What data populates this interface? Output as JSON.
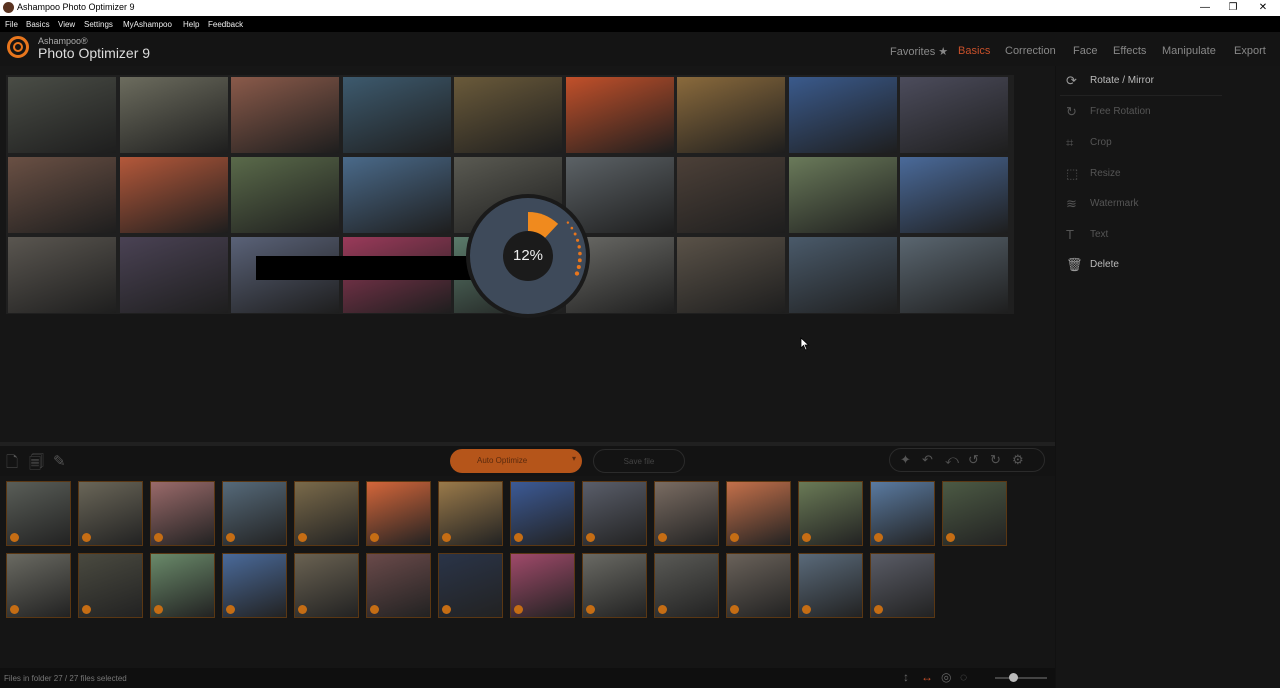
{
  "window": {
    "title": "Ashampoo Photo Optimizer 9",
    "minimize": "—",
    "maximize": "❐",
    "close": "✕"
  },
  "menu": [
    "File",
    "Basics",
    "View",
    "Settings",
    "MyAshampoo",
    "Help",
    "Feedback"
  ],
  "brand": {
    "small": "Ashampoo®",
    "name": "Photo Optimizer 9"
  },
  "nav": [
    {
      "label": "Favorites ★",
      "active": false
    },
    {
      "label": "Basics",
      "active": true
    },
    {
      "label": "Correction",
      "active": false
    },
    {
      "label": "Face",
      "active": false
    },
    {
      "label": "Effects",
      "active": false
    },
    {
      "label": "Manipulate",
      "active": false
    },
    {
      "label": "Export",
      "active": false
    }
  ],
  "progress": {
    "percent_label": "12%",
    "value": 0.12
  },
  "right_panel": [
    {
      "label": "Rotate / Mirror",
      "icon": "rotate-icon",
      "enabled": true
    },
    {
      "label": "Free Rotation",
      "icon": "free-rotation-icon",
      "enabled": false
    },
    {
      "label": "Crop",
      "icon": "crop-icon",
      "enabled": false
    },
    {
      "label": "Resize",
      "icon": "resize-icon",
      "enabled": false
    },
    {
      "label": "Watermark",
      "icon": "watermark-icon",
      "enabled": false
    },
    {
      "label": "Text",
      "icon": "text-icon",
      "enabled": false
    },
    {
      "label": "Delete",
      "icon": "trash-icon",
      "enabled": true
    }
  ],
  "toolbar": {
    "auto_optimize": "Auto Optimize",
    "save_file": "Save file"
  },
  "status": {
    "text": "Files in folder 27 / 27 files selected"
  },
  "colors": {
    "accent": "#e8761d",
    "active_tab": "#c8502a",
    "background": "#111111"
  },
  "photos": [
    "#4a4d46",
    "#6c6c5e",
    "#8a5a4a",
    "#3d5a6e",
    "#6a5a3a",
    "#c2502a",
    "#8a6a3c",
    "#3a5a8c",
    "#4c4c5c",
    "#6a5044",
    "#b4583a",
    "#5a6a4a",
    "#4a6a8a",
    "#5a5a52",
    "#5c6266",
    "#4c4038",
    "#6a7a5a",
    "#4a6a9a",
    "#5a5650",
    "#4a4254",
    "#5a6278",
    "#9a3a5a",
    "#5a7a6a",
    "#6a6a66",
    "#5a5248",
    "#4a5a6a",
    "#5a6670"
  ],
  "thumbs_row1": [
    "#5a5e58",
    "#6a6658",
    "#9a6a6a",
    "#566a7a",
    "#7a6a4a",
    "#d4663a",
    "#9a7a4a",
    "#3c5a96",
    "#5a5e6a",
    "#7a6c62",
    "#c4704a",
    "#6a7a56",
    "#5a7aa0",
    "#4c5a44"
  ],
  "thumbs_row2": [
    "#6a6a62",
    "#4a4a40",
    "#6a8a6a",
    "#4a6a9a",
    "#6a6252",
    "#6a4a4a",
    "#2a3448",
    "#a04a6a",
    "#6a6a64",
    "#5a5a56",
    "#6a625a",
    "#5a6a7a",
    "#5a5c66"
  ]
}
